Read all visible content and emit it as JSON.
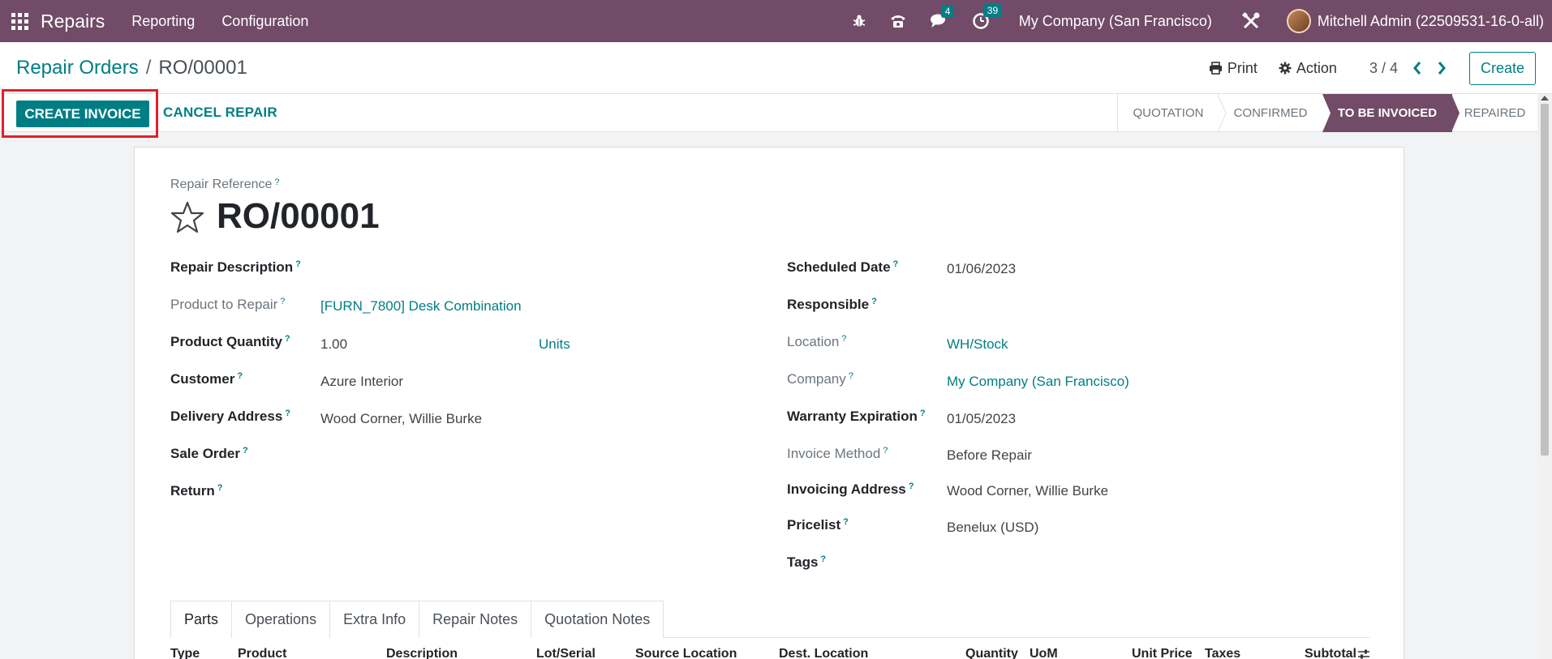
{
  "navbar": {
    "brand": "Repairs",
    "menus": [
      "Reporting",
      "Configuration"
    ],
    "messages_count": "4",
    "activities_count": "39",
    "company": "My Company (San Francisco)",
    "user": "Mitchell Admin (22509531-16-0-all)",
    "bg_color": "#714b67"
  },
  "control_panel": {
    "breadcrumb_parent": "Repair Orders",
    "breadcrumb_current": "RO/00001",
    "print_label": "Print",
    "action_label": "Action",
    "pager": "3 / 4",
    "create_label": "Create"
  },
  "statusbar": {
    "create_invoice_label": "CREATE INVOICE",
    "cancel_repair_label": "CANCEL REPAIR",
    "stages": [
      "QUOTATION",
      "CONFIRMED",
      "TO BE INVOICED",
      "REPAIRED"
    ],
    "active_stage": "TO BE INVOICED"
  },
  "form": {
    "ref_label": "Repair Reference",
    "ref_value": "RO/00001",
    "left": {
      "repair_description": {
        "label": "Repair Description",
        "value": ""
      },
      "product_to_repair": {
        "label": "Product to Repair",
        "value": "[FURN_7800] Desk Combination"
      },
      "product_quantity": {
        "label": "Product Quantity",
        "value": "1.00",
        "uom": "Units"
      },
      "customer": {
        "label": "Customer",
        "value": "Azure Interior"
      },
      "delivery_address": {
        "label": "Delivery Address",
        "value": "Wood Corner, Willie Burke"
      },
      "sale_order": {
        "label": "Sale Order",
        "value": ""
      },
      "return": {
        "label": "Return",
        "value": ""
      }
    },
    "right": {
      "scheduled_date": {
        "label": "Scheduled Date",
        "value": "01/06/2023"
      },
      "responsible": {
        "label": "Responsible",
        "value": ""
      },
      "location": {
        "label": "Location",
        "value": "WH/Stock"
      },
      "company": {
        "label": "Company",
        "value": "My Company (San Francisco)"
      },
      "warranty_expiration": {
        "label": "Warranty Expiration",
        "value": "01/05/2023"
      },
      "invoice_method": {
        "label": "Invoice Method",
        "value": "Before Repair"
      },
      "invoicing_address": {
        "label": "Invoicing Address",
        "value": "Wood Corner, Willie Burke"
      },
      "pricelist": {
        "label": "Pricelist",
        "value": "Benelux (USD)"
      },
      "tags": {
        "label": "Tags",
        "value": ""
      }
    }
  },
  "tabs": [
    "Parts",
    "Operations",
    "Extra Info",
    "Repair Notes",
    "Quotation Notes"
  ],
  "active_tab": "Parts",
  "table_headers": [
    "Type",
    "Product",
    "Description",
    "Lot/Serial",
    "Source Location",
    "Dest. Location",
    "Quantity",
    "UoM",
    "Unit Price",
    "Taxes",
    "Subtotal"
  ],
  "q_mark": "?"
}
